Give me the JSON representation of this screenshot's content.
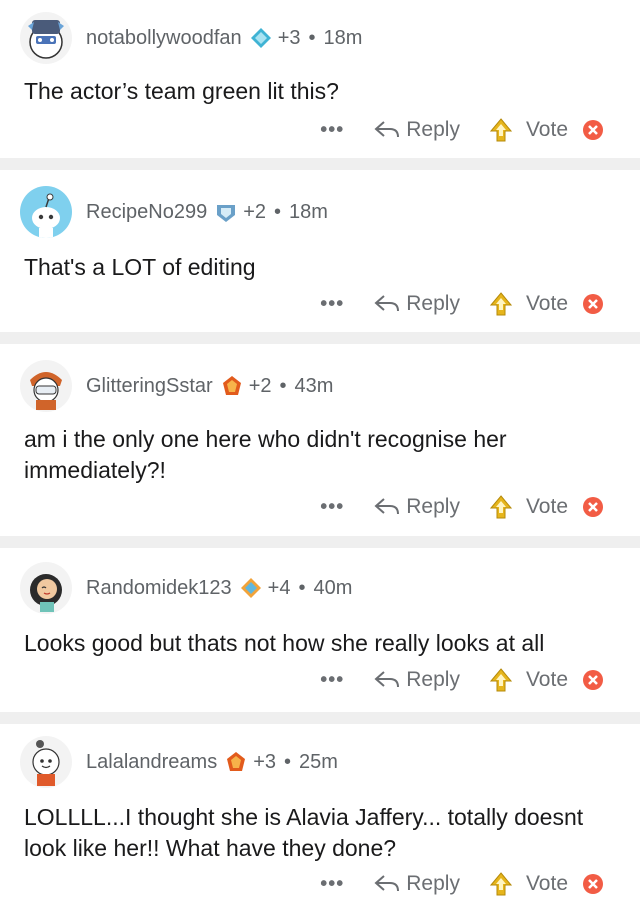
{
  "comments": [
    {
      "username": "notabollywoodfan",
      "karma": "+3",
      "separator": "•",
      "time": "18m",
      "body": "The actor’s team green lit this?",
      "award_color": "#3fb3d4"
    },
    {
      "username": "RecipeNo299",
      "karma": "+2",
      "separator": "•",
      "time": "18m",
      "body": "That's a LOT of editing",
      "award_color": "#6aa0c8"
    },
    {
      "username": "GlitteringSstar",
      "karma": "+2",
      "separator": "•",
      "time": "43m",
      "body": "am i the only one here who didn't recognise her immediately?!",
      "award_color": "#e25b1c"
    },
    {
      "username": "Randomidek123",
      "karma": "+4",
      "separator": "•",
      "time": "40m",
      "body": "Looks good but thats not how she really looks at all",
      "award_color": "#f2a33a"
    },
    {
      "username": "Lalalandreams",
      "karma": "+3",
      "separator": "•",
      "time": "25m",
      "body": "LOLLLL...I thought she is Alavia Jaffery... totally doesnt look like her!! What have they done?",
      "award_color": "#e25b1c"
    }
  ],
  "actions": {
    "more": "•••",
    "reply": "Reply",
    "vote": "Vote"
  },
  "colors": {
    "upvote": "#e6b51c",
    "downvote": "#f25c45",
    "divider": "#efefef",
    "meta_text": "#5f6367"
  },
  "icons": [
    "more-options-icon",
    "reply-arrow-icon",
    "upvote-arrow-icon",
    "downvote-x-icon",
    "award-badge-icon"
  ]
}
